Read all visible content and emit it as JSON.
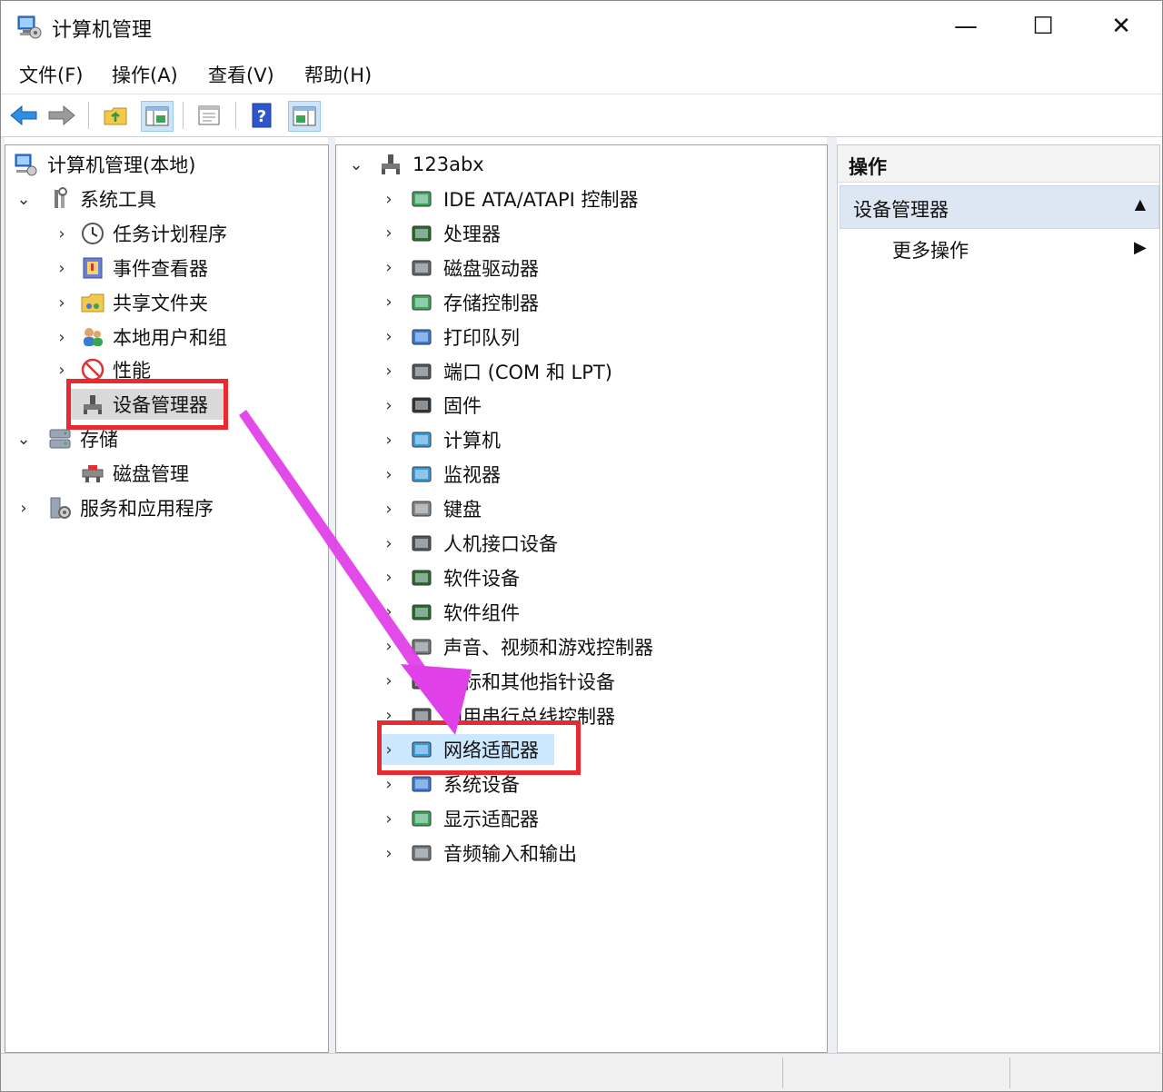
{
  "window": {
    "title": "计算机管理",
    "controls": {
      "minimize": "—",
      "maximize": "☐",
      "close": "✕"
    }
  },
  "menu": [
    "文件(F)",
    "操作(A)",
    "查看(V)",
    "帮助(H)"
  ],
  "toolbar": [
    "back-icon",
    "forward-icon",
    "up-folder-icon",
    "show-hide-tree-icon",
    "properties-icon",
    "help-icon",
    "show-action-pane-icon"
  ],
  "left_tree": {
    "root": "计算机管理(本地)",
    "system_tools": "系统工具",
    "system_tools_items": [
      "任务计划程序",
      "事件查看器",
      "共享文件夹",
      "本地用户和组",
      "性能",
      "设备管理器"
    ],
    "storage": "存储",
    "storage_items": [
      "磁盘管理"
    ],
    "services": "服务和应用程序"
  },
  "device_tree": {
    "computer": "123abx",
    "categories": [
      "IDE ATA/ATAPI 控制器",
      "处理器",
      "磁盘驱动器",
      "存储控制器",
      "打印队列",
      "端口 (COM 和 LPT)",
      "固件",
      "计算机",
      "监视器",
      "键盘",
      "人机接口设备",
      "软件设备",
      "软件组件",
      "声音、视频和游戏控制器",
      "鼠标和其他指针设备",
      "通用串行总线控制器",
      "网络适配器",
      "系统设备",
      "显示适配器",
      "音频输入和输出"
    ]
  },
  "actions": {
    "header": "操作",
    "section": "设备管理器",
    "more": "更多操作"
  },
  "annotation": {
    "box_color": "#e8292f",
    "arrow_color": "#e040e8"
  }
}
